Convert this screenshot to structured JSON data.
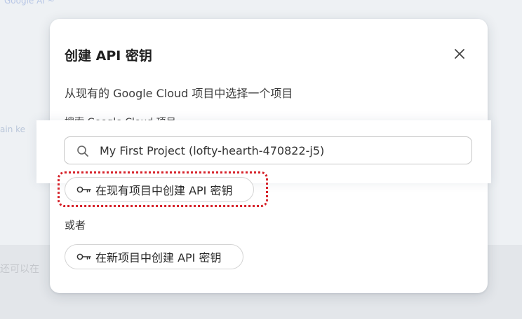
{
  "background": {
    "top_link": "Google AI ~",
    "left_text": "ain ke",
    "bottom_text": "还可以在"
  },
  "dialog": {
    "title": "创建 API 密钥",
    "close_icon": "close-icon",
    "description": "从现有的 Google Cloud 项目中选择一个项目",
    "search_label": "搜索 Google Cloud 项目",
    "search": {
      "icon": "search-icon",
      "value": "My First Project (lofty-hearth-470822-j5)"
    },
    "create_existing_button": {
      "icon": "key-icon",
      "label": "在现有项目中创建 API 密钥"
    },
    "or_label": "或者",
    "create_new_button": {
      "icon": "key-icon",
      "label": "在新项目中创建 API 密钥"
    }
  },
  "colors": {
    "focus_ring": "#d6222a",
    "modal_bg": "#ffffff",
    "page_bg": "#eef1f4"
  }
}
